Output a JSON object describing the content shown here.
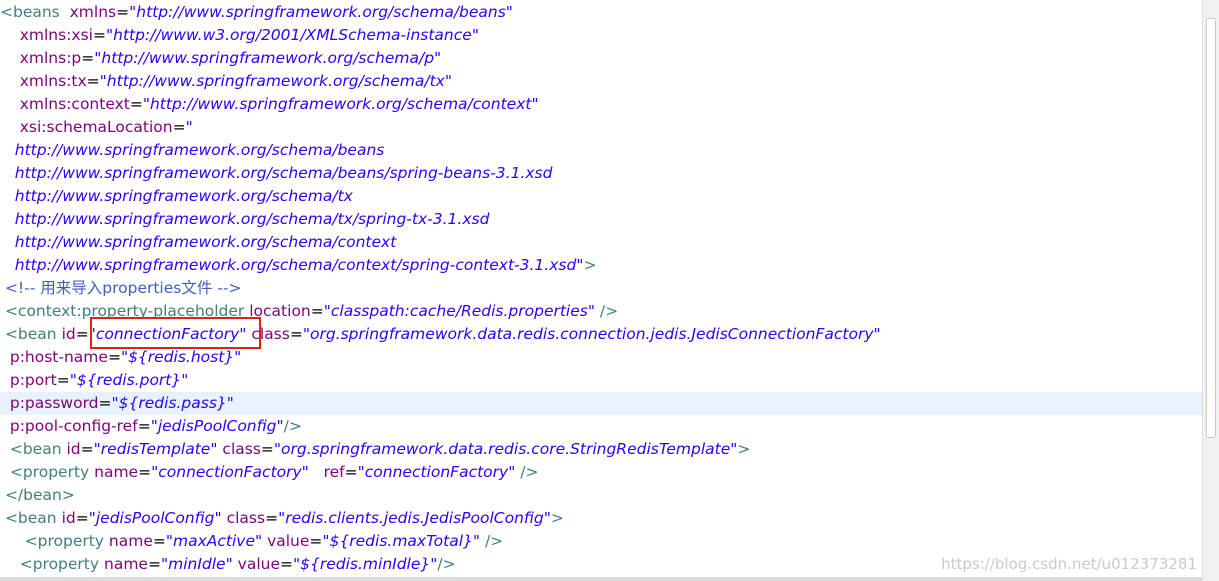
{
  "editor": {
    "lines": [
      {
        "parts": [
          {
            "t": "tag",
            "s": "<beans"
          },
          {
            "t": "plain",
            "s": "  "
          },
          {
            "t": "attr",
            "s": "xmlns"
          },
          {
            "t": "eq",
            "s": "="
          },
          {
            "t": "val",
            "s": "\"http://www.springframework.org/schema/beans\""
          }
        ]
      },
      {
        "parts": [
          {
            "t": "plain",
            "s": "    "
          },
          {
            "t": "attr",
            "s": "xmlns:xsi"
          },
          {
            "t": "eq",
            "s": "="
          },
          {
            "t": "val",
            "s": "\"http://www.w3.org/2001/XMLSchema-instance\""
          }
        ]
      },
      {
        "parts": [
          {
            "t": "plain",
            "s": "    "
          },
          {
            "t": "attr",
            "s": "xmlns:p"
          },
          {
            "t": "eq",
            "s": "="
          },
          {
            "t": "val",
            "s": "\"http://www.springframework.org/schema/p\""
          }
        ]
      },
      {
        "parts": [
          {
            "t": "plain",
            "s": "    "
          },
          {
            "t": "attr",
            "s": "xmlns:tx"
          },
          {
            "t": "eq",
            "s": "="
          },
          {
            "t": "val",
            "s": "\"http://www.springframework.org/schema/tx\""
          }
        ]
      },
      {
        "parts": [
          {
            "t": "plain",
            "s": "    "
          },
          {
            "t": "attr",
            "s": "xmlns:context"
          },
          {
            "t": "eq",
            "s": "="
          },
          {
            "t": "val",
            "s": "\"http://www.springframework.org/schema/context\""
          }
        ]
      },
      {
        "parts": [
          {
            "t": "plain",
            "s": "    "
          },
          {
            "t": "attr",
            "s": "xsi:schemaLocation"
          },
          {
            "t": "eq",
            "s": "="
          },
          {
            "t": "val",
            "s": "\""
          }
        ]
      },
      {
        "parts": [
          {
            "t": "plain",
            "s": "   "
          },
          {
            "t": "val",
            "s": "http://www.springframework.org/schema/beans"
          }
        ]
      },
      {
        "parts": [
          {
            "t": "plain",
            "s": "   "
          },
          {
            "t": "val",
            "s": "http://www.springframework.org/schema/beans/spring-beans-3.1.xsd"
          }
        ]
      },
      {
        "parts": [
          {
            "t": "plain",
            "s": "   "
          },
          {
            "t": "val",
            "s": "http://www.springframework.org/schema/tx"
          }
        ]
      },
      {
        "parts": [
          {
            "t": "plain",
            "s": "   "
          },
          {
            "t": "val",
            "s": "http://www.springframework.org/schema/tx/spring-tx-3.1.xsd"
          }
        ]
      },
      {
        "parts": [
          {
            "t": "plain",
            "s": "   "
          },
          {
            "t": "val",
            "s": "http://www.springframework.org/schema/context"
          }
        ]
      },
      {
        "parts": [
          {
            "t": "plain",
            "s": "   "
          },
          {
            "t": "val",
            "s": "http://www.springframework.org/schema/context/spring-context-3.1.xsd\""
          },
          {
            "t": "tag",
            "s": ">"
          }
        ]
      },
      {
        "parts": [
          {
            "t": "plain",
            "s": " "
          },
          {
            "t": "cmt",
            "s": "<!-- 用来导入properties文件 -->"
          }
        ]
      },
      {
        "parts": [
          {
            "t": "plain",
            "s": " "
          },
          {
            "t": "tag",
            "s": "<context:property-placeholder"
          },
          {
            "t": "plain",
            "s": " "
          },
          {
            "t": "attr",
            "s": "location"
          },
          {
            "t": "eq",
            "s": "="
          },
          {
            "t": "val",
            "s": "\"classpath:cache/Redis.properties\""
          },
          {
            "t": "plain",
            "s": " "
          },
          {
            "t": "tag",
            "s": "/>"
          }
        ]
      },
      {
        "parts": [
          {
            "t": "plain",
            "s": " "
          },
          {
            "t": "tag",
            "s": "<bean"
          },
          {
            "t": "plain",
            "s": " "
          },
          {
            "t": "attr",
            "s": "id"
          },
          {
            "t": "eq",
            "s": "="
          },
          {
            "t": "val",
            "s": "\"connectionFactory\""
          },
          {
            "t": "plain",
            "s": " "
          },
          {
            "t": "attr",
            "s": "class"
          },
          {
            "t": "eq",
            "s": "="
          },
          {
            "t": "val",
            "s": "\"org.springframework.data.redis.connection.jedis.JedisConnectionFactory\""
          }
        ]
      },
      {
        "parts": [
          {
            "t": "plain",
            "s": "  "
          },
          {
            "t": "attr",
            "s": "p:host-name"
          },
          {
            "t": "eq",
            "s": "="
          },
          {
            "t": "val",
            "s": "\"${redis.host}\""
          }
        ]
      },
      {
        "parts": [
          {
            "t": "plain",
            "s": "  "
          },
          {
            "t": "attr",
            "s": "p:port"
          },
          {
            "t": "eq",
            "s": "="
          },
          {
            "t": "val",
            "s": "\"${redis.port}\""
          }
        ]
      },
      {
        "current": true,
        "parts": [
          {
            "t": "plain",
            "s": "  "
          },
          {
            "t": "attr",
            "s": "p:password"
          },
          {
            "t": "eq",
            "s": "="
          },
          {
            "t": "val",
            "s": "\"${redis.pass}\""
          }
        ]
      },
      {
        "parts": [
          {
            "t": "plain",
            "s": "  "
          },
          {
            "t": "attr",
            "s": "p:pool-config-ref"
          },
          {
            "t": "eq",
            "s": "="
          },
          {
            "t": "val",
            "s": "\"jedisPoolConfig\""
          },
          {
            "t": "tag",
            "s": "/>"
          }
        ]
      },
      {
        "parts": [
          {
            "t": "plain",
            "s": "  "
          },
          {
            "t": "tag",
            "s": "<bean"
          },
          {
            "t": "plain",
            "s": " "
          },
          {
            "t": "attr",
            "s": "id"
          },
          {
            "t": "eq",
            "s": "="
          },
          {
            "t": "val",
            "s": "\"redisTemplate\""
          },
          {
            "t": "plain",
            "s": " "
          },
          {
            "t": "attr",
            "s": "class"
          },
          {
            "t": "eq",
            "s": "="
          },
          {
            "t": "val",
            "s": "\"org.springframework.data.redis.core.StringRedisTemplate\""
          },
          {
            "t": "tag",
            "s": ">"
          }
        ]
      },
      {
        "parts": [
          {
            "t": "plain",
            "s": "  "
          },
          {
            "t": "tag",
            "s": "<property"
          },
          {
            "t": "plain",
            "s": " "
          },
          {
            "t": "attr",
            "s": "name"
          },
          {
            "t": "eq",
            "s": "="
          },
          {
            "t": "val",
            "s": "\"connectionFactory\""
          },
          {
            "t": "plain",
            "s": "   "
          },
          {
            "t": "attr",
            "s": "ref"
          },
          {
            "t": "eq",
            "s": "="
          },
          {
            "t": "val",
            "s": "\"connectionFactory\""
          },
          {
            "t": "plain",
            "s": " "
          },
          {
            "t": "tag",
            "s": "/>"
          }
        ]
      },
      {
        "parts": [
          {
            "t": "plain",
            "s": " "
          },
          {
            "t": "tag",
            "s": "</bean>"
          }
        ]
      },
      {
        "parts": [
          {
            "t": "plain",
            "s": " "
          },
          {
            "t": "tag",
            "s": "<bean"
          },
          {
            "t": "plain",
            "s": " "
          },
          {
            "t": "attr",
            "s": "id"
          },
          {
            "t": "eq",
            "s": "="
          },
          {
            "t": "val",
            "s": "\"jedisPoolConfig\""
          },
          {
            "t": "plain",
            "s": " "
          },
          {
            "t": "attr",
            "s": "class"
          },
          {
            "t": "eq",
            "s": "="
          },
          {
            "t": "val",
            "s": "\"redis.clients.jedis.JedisPoolConfig\""
          },
          {
            "t": "tag",
            "s": ">"
          }
        ]
      },
      {
        "parts": [
          {
            "t": "plain",
            "s": "     "
          },
          {
            "t": "tag",
            "s": "<property"
          },
          {
            "t": "plain",
            "s": " "
          },
          {
            "t": "attr",
            "s": "name"
          },
          {
            "t": "eq",
            "s": "="
          },
          {
            "t": "val",
            "s": "\"maxActive\""
          },
          {
            "t": "plain",
            "s": " "
          },
          {
            "t": "attr",
            "s": "value"
          },
          {
            "t": "eq",
            "s": "="
          },
          {
            "t": "val",
            "s": "\"${redis.maxTotal}\""
          },
          {
            "t": "plain",
            "s": " "
          },
          {
            "t": "tag",
            "s": "/>"
          }
        ]
      },
      {
        "parts": [
          {
            "t": "plain",
            "s": "    "
          },
          {
            "t": "tag",
            "s": "<property"
          },
          {
            "t": "plain",
            "s": " "
          },
          {
            "t": "attr",
            "s": "name"
          },
          {
            "t": "eq",
            "s": "="
          },
          {
            "t": "val",
            "s": "\"minIdle\""
          },
          {
            "t": "plain",
            "s": " "
          },
          {
            "t": "attr",
            "s": "value"
          },
          {
            "t": "eq",
            "s": "="
          },
          {
            "t": "val",
            "s": "\"${redis.minIdle}\""
          },
          {
            "t": "tag",
            "s": "/>"
          }
        ]
      }
    ]
  },
  "watermark": "https://blog.csdn.net/u012373281"
}
